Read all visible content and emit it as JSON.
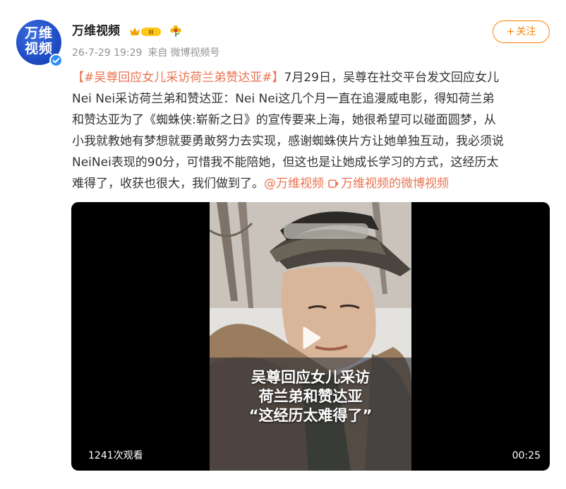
{
  "account": {
    "name": "万维视频",
    "avatar_text_1": "万维",
    "avatar_text_2": "视频",
    "level_badge": "II",
    "meta_date": "26-7-29 19:29",
    "meta_source_prefix": "来自",
    "meta_source": "微博视频号",
    "follow_label": "关注",
    "follow_plus": "+"
  },
  "post": {
    "hashtag": "【#吴尊回应女儿采访荷兰弟赞达亚#】",
    "line1_rest": "7月29日，吴尊在社交平台发文回应女儿",
    "line2": "Nei Nei采访荷兰弟和赞达亚：Nei Nei这几个月一直在追漫威电影，得知荷兰弟",
    "line3": "和赞达亚为了《蜘蛛侠:崭新之日》的宣传要来上海，她很希望可以碰面圆梦，从",
    "line4": "小我就教她有梦想就要勇敢努力去实现，感谢蜘蛛侠片方让她单独互动，我必须说",
    "line5": "NeiNei表现的90分，可惜我不能陪她，但这也是让她成长学习的方式，这经历太",
    "line6_text": "难得了，收获也很大，我们做到了。",
    "mention": "@万维视频",
    "video_link": "万维视频的微博视频"
  },
  "video": {
    "caption_1": "吴尊回应女儿采访",
    "caption_2": "荷兰弟和赞达亚",
    "caption_3": "“这经历太难得了”",
    "views": "1241次观看",
    "duration": "00:25"
  },
  "colors": {
    "accent": "#ff8200",
    "link": "#eb7350",
    "meta": "#939393",
    "verified": "#2f8ef5",
    "avatar": "#1f4cc4"
  },
  "icons": [
    "verified-icon",
    "level-badge-icon",
    "flower-icon",
    "play-icon",
    "video-link-icon"
  ]
}
